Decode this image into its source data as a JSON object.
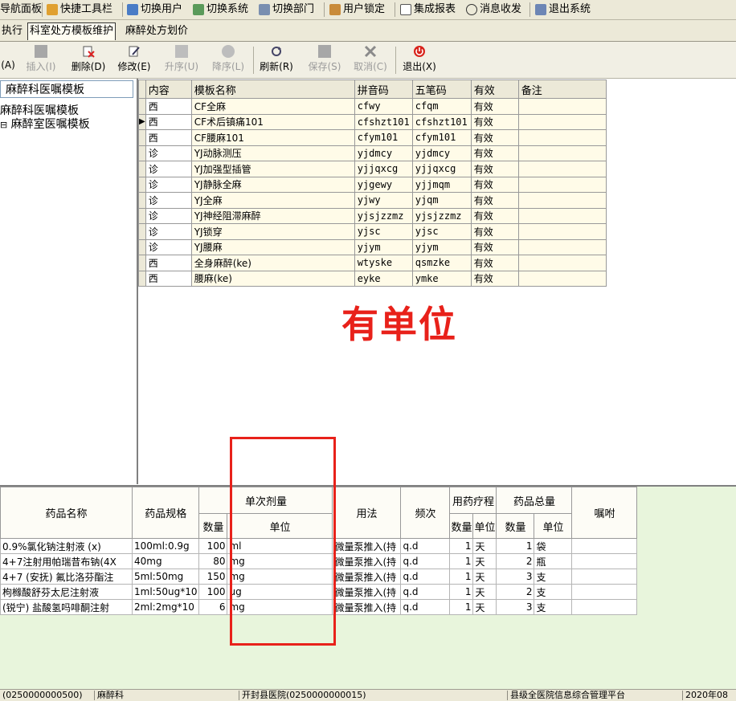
{
  "menu": {
    "items": [
      {
        "label": "导航面板",
        "icon": "nav-panel-icon"
      },
      {
        "label": "快捷工具栏",
        "icon": "quick-tools-icon"
      },
      {
        "label": "切换用户",
        "icon": "switch-user-icon"
      },
      {
        "label": "切换系统",
        "icon": "switch-system-icon"
      },
      {
        "label": "切换部门",
        "icon": "switch-dept-icon"
      },
      {
        "label": "用户锁定",
        "icon": "user-lock-icon"
      },
      {
        "label": "集成报表",
        "icon": "report-icon"
      },
      {
        "label": "消息收发",
        "icon": "message-icon"
      },
      {
        "label": "退出系统",
        "icon": "exit-system-icon"
      }
    ]
  },
  "tabs": [
    {
      "label": "执行",
      "active": false
    },
    {
      "label": "科室处方模板维护",
      "active": true
    },
    {
      "label": "麻醉处方划价",
      "active": false
    }
  ],
  "toolbar": {
    "buttons": [
      {
        "label": "(A)",
        "enabled": true,
        "icon": "add-icon"
      },
      {
        "label": "插入(I)",
        "enabled": false,
        "icon": "insert-icon"
      },
      {
        "label": "删除(D)",
        "enabled": true,
        "icon": "delete-icon"
      },
      {
        "label": "修改(E)",
        "enabled": true,
        "icon": "edit-icon"
      },
      {
        "label": "升序(U)",
        "enabled": false,
        "icon": "sort-up-icon"
      },
      {
        "label": "降序(L)",
        "enabled": false,
        "icon": "sort-down-icon"
      },
      {
        "label": "刷新(R)",
        "enabled": true,
        "icon": "refresh-icon"
      },
      {
        "label": "保存(S)",
        "enabled": false,
        "icon": "save-icon"
      },
      {
        "label": "取消(C)",
        "enabled": false,
        "icon": "cancel-icon"
      },
      {
        "label": "退出(X)",
        "enabled": true,
        "icon": "power-icon"
      }
    ]
  },
  "tree": {
    "header": "麻醉科医嘱模板",
    "nodes": [
      {
        "label": "麻醉科医嘱模板",
        "indent": 0,
        "expand": ""
      },
      {
        "label": "麻醉室医嘱模板",
        "indent": 1,
        "expand": "⊟"
      }
    ]
  },
  "template_grid": {
    "columns": [
      "内容",
      "模板名称",
      "拼音码",
      "五笔码",
      "有效",
      "备注"
    ],
    "current_row": 1,
    "rows": [
      [
        "西",
        "CF全麻",
        "cfwy",
        "cfqm",
        "有效",
        ""
      ],
      [
        "西",
        "CF术后镇痛101",
        "cfshzt101",
        "cfshzt101",
        "有效",
        ""
      ],
      [
        "西",
        "CF腰麻101",
        "cfym101",
        "cfym101",
        "有效",
        ""
      ],
      [
        "诊",
        "YJ动脉测压",
        "yjdmcy",
        "yjdmcy",
        "有效",
        ""
      ],
      [
        "诊",
        "YJ加强型插管",
        "yjjqxcg",
        "yjjqxcg",
        "有效",
        ""
      ],
      [
        "诊",
        "YJ静脉全麻",
        "yjgewy",
        "yjjmqm",
        "有效",
        ""
      ],
      [
        "诊",
        "YJ全麻",
        "yjwy",
        "yjqm",
        "有效",
        ""
      ],
      [
        "诊",
        "YJ神经阻滞麻醉",
        "yjsjzzmz",
        "yjsjzzmz",
        "有效",
        ""
      ],
      [
        "诊",
        "YJ锁穿",
        "yjsc",
        "yjsc",
        "有效",
        ""
      ],
      [
        "诊",
        "YJ腰麻",
        "yjym",
        "yjym",
        "有效",
        ""
      ],
      [
        "西",
        "全身麻醉(ke)",
        "wtyske",
        "qsmzke",
        "有效",
        ""
      ],
      [
        "西",
        "腰麻(ke)",
        "eyke",
        "ymke",
        "有效",
        ""
      ]
    ]
  },
  "annotation": {
    "text": "有单位",
    "color": "#e8211a"
  },
  "drug_grid": {
    "headers": {
      "drug_name": "药品名称",
      "spec": "药品规格",
      "single_dose": "单次剂量",
      "single_qty": "数量",
      "single_unit": "单位",
      "usage": "用法",
      "frequency": "频次",
      "course": "用药疗程",
      "course_qty": "数量",
      "course_unit": "单位",
      "total": "药品总量",
      "total_qty": "数量",
      "total_unit": "单位",
      "instruction": "嘱咐"
    },
    "rows": [
      {
        "name": "0.9%氯化钠注射液 (x)",
        "spec": "100ml:0.9g",
        "dose": "100",
        "unit": "ml",
        "usage": "微量泵推入(持",
        "freq": "q.d",
        "days": "1",
        "day_unit": "天",
        "total": "1",
        "total_unit": "袋",
        "note": ""
      },
      {
        "name": "4+7注射用帕瑞昔布钠(4X",
        "spec": "40mg",
        "dose": "80",
        "unit": "mg",
        "usage": "微量泵推入(持",
        "freq": "q.d",
        "days": "1",
        "day_unit": "天",
        "total": "2",
        "total_unit": "瓶",
        "note": ""
      },
      {
        "name": "4+7 (安抚) 氟比洛芬酯注",
        "spec": "5ml:50mg",
        "dose": "150",
        "unit": "mg",
        "usage": "微量泵推入(持",
        "freq": "q.d",
        "days": "1",
        "day_unit": "天",
        "total": "3",
        "total_unit": "支",
        "note": ""
      },
      {
        "name": "枸橼酸舒芬太尼注射液",
        "spec": "1ml:50ug*10",
        "dose": "100",
        "unit": "ug",
        "usage": "微量泵推入(持",
        "freq": "q.d",
        "days": "1",
        "day_unit": "天",
        "total": "2",
        "total_unit": "支",
        "note": ""
      },
      {
        "name": "(锐宁) 盐酸氢吗啡酮注射",
        "spec": "2ml:2mg*10",
        "dose": "6",
        "unit": "mg",
        "usage": "微量泵推入(持",
        "freq": "q.d",
        "days": "1",
        "day_unit": "天",
        "total": "3",
        "total_unit": "支",
        "note": ""
      }
    ]
  },
  "statusbar": {
    "cells": [
      "(0250000000500)",
      "麻醉科",
      "开封县医院(0250000000015)",
      "县级全医院信息综合管理平台",
      "2020年08"
    ]
  },
  "colors": {
    "highlight_red": "#e8211a",
    "grid_bg": "#e8f5dc"
  }
}
